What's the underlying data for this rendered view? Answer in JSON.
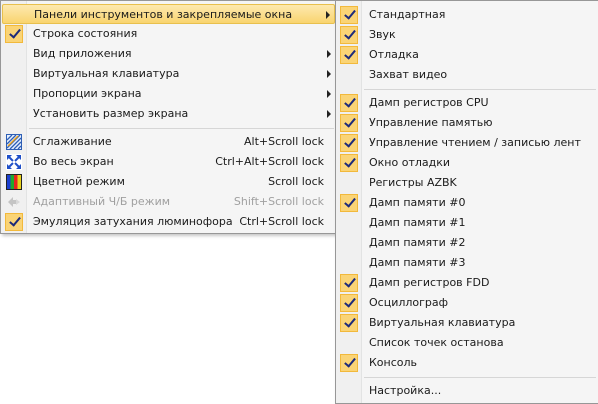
{
  "view_menu": {
    "items": [
      {
        "label": "Панели инструментов и закрепляемые окна",
        "submenu": true,
        "highlighted": true
      },
      {
        "label": "Строка состояния",
        "checked": true
      },
      {
        "label": "Вид приложения",
        "submenu": true
      },
      {
        "label": "Виртуальная клавиатура",
        "submenu": true
      },
      {
        "label": "Пропорции экрана",
        "submenu": true
      },
      {
        "label": "Установить размер экрана",
        "submenu": true
      },
      {
        "label": "Сглаживание",
        "shortcut": "Alt+Scroll lock",
        "icon": "smoothing-icon"
      },
      {
        "label": "Во весь экран",
        "shortcut": "Ctrl+Alt+Scroll lock",
        "icon": "fullscreen-icon"
      },
      {
        "label": "Цветной режим",
        "shortcut": "Scroll lock",
        "icon": "color-mode-icon"
      },
      {
        "label": "Адаптивный Ч/Б режим",
        "shortcut": "Shift+Scroll lock",
        "icon": "adaptive-bw-icon",
        "disabled": true
      },
      {
        "label": "Эмуляция затухания люминофора",
        "shortcut": "Ctrl+Scroll lock",
        "checked": true
      }
    ]
  },
  "toolbars_submenu": {
    "items": [
      {
        "label": "Стандартная",
        "checked": true
      },
      {
        "label": "Звук",
        "checked": true
      },
      {
        "label": "Отладка",
        "checked": true
      },
      {
        "label": "Захват видео",
        "checked": false
      },
      {
        "label": "Дамп регистров CPU",
        "checked": true
      },
      {
        "label": "Управление памятью",
        "checked": true
      },
      {
        "label": "Управление чтением / записью лент",
        "checked": true
      },
      {
        "label": "Окно отладки",
        "checked": true
      },
      {
        "label": "Регистры AZBK",
        "checked": false
      },
      {
        "label": "Дамп памяти #0",
        "checked": true
      },
      {
        "label": "Дамп памяти #1",
        "checked": false
      },
      {
        "label": "Дамп памяти #2",
        "checked": false
      },
      {
        "label": "Дамп памяти #3",
        "checked": false
      },
      {
        "label": "Дамп регистров FDD",
        "checked": true
      },
      {
        "label": "Осциллограф",
        "checked": true
      },
      {
        "label": "Виртуальная клавиатура",
        "checked": true
      },
      {
        "label": "Список точек останова",
        "checked": false
      },
      {
        "label": "Консоль",
        "checked": true
      },
      {
        "label": "Настройка...",
        "checked": false
      }
    ]
  },
  "colors": {
    "highlight": "#f9d46f",
    "check_background": "#fad476",
    "menu_background": "#f5f5f5",
    "disabled_text": "#a0a0a0"
  }
}
